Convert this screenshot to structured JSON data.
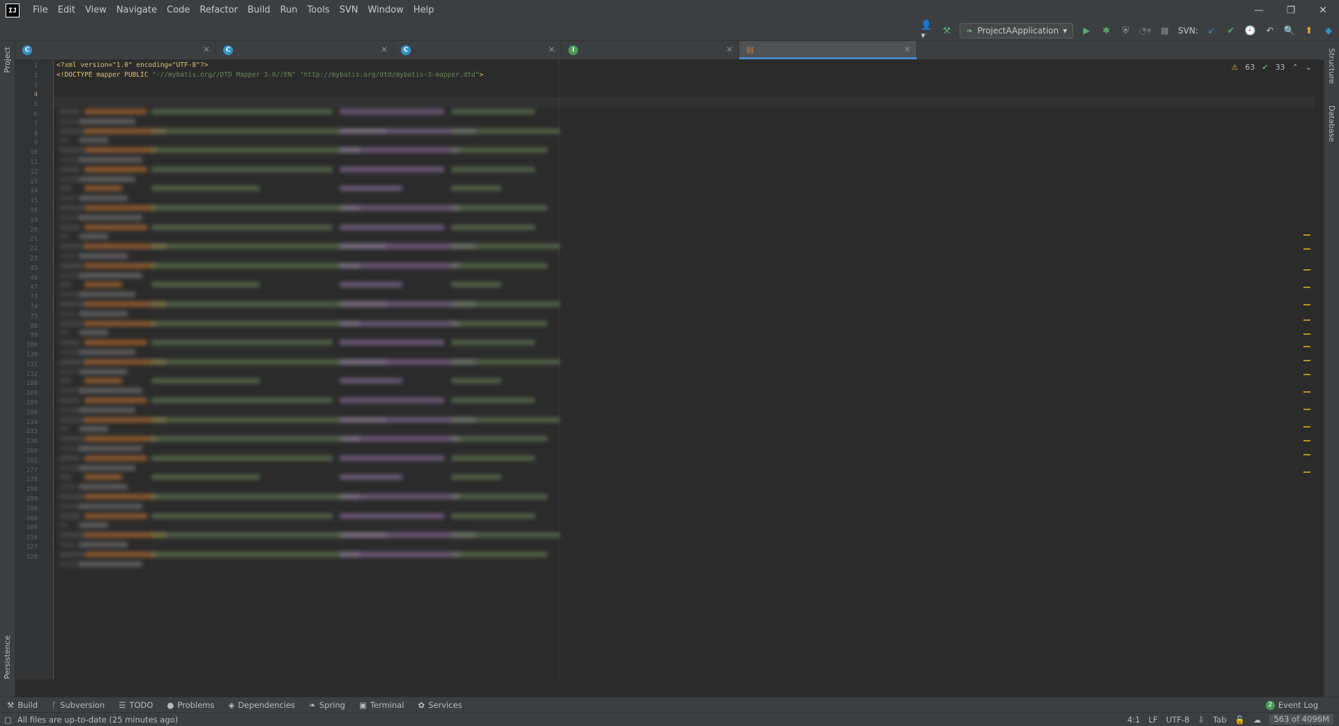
{
  "menu": [
    "File",
    "Edit",
    "View",
    "Navigate",
    "Code",
    "Refactor",
    "Build",
    "Run",
    "Tools",
    "SVN",
    "Window",
    "Help"
  ],
  "app_logo": "IJ",
  "toolbar": {
    "run_config": "ProjectAApplication",
    "svn_label": "SVN:"
  },
  "tabs": [
    {
      "icon": "C",
      "color": "#3592c4"
    },
    {
      "icon": "C",
      "color": "#3592c4"
    },
    {
      "icon": "C",
      "color": "#3592c4"
    },
    {
      "icon": "I",
      "color": "#499c54"
    },
    {
      "icon": "xml",
      "color": "#cc7832"
    }
  ],
  "side": {
    "project": "Project",
    "persistence": "Persistence",
    "structure": "Structure",
    "database": "Database"
  },
  "editor": {
    "line1": "<?xml version=\"1.0\" encoding=\"UTF-8\"?>",
    "line2_a": "<!DOCTYPE mapper PUBLIC ",
    "line2_b": "\"-//mybatis.org//DTD Mapper 3.0//EN\"",
    "line2_c": " ",
    "line2_d": "\"http://mybatis.org/dtd/mybatis-3-mapper.dtd\"",
    "line2_e": ">",
    "line_numbers": [
      "1",
      "2",
      "3",
      "4",
      "5",
      "6",
      "7",
      "8",
      "9",
      "10",
      "11",
      "12",
      "13",
      "14",
      "15",
      "16",
      "19",
      "20",
      "21",
      "22",
      "23",
      "45",
      "46",
      "47",
      "73",
      "74",
      "75",
      "88",
      "99",
      "100",
      "130",
      "131",
      "132",
      "168",
      "169",
      "199",
      "200",
      "234",
      "235",
      "236",
      "260",
      "261",
      "277",
      "278",
      "298",
      "299",
      "300",
      "308",
      "309",
      "310",
      "327",
      "328"
    ],
    "warnings": "63",
    "checks": "33"
  },
  "bottom_tools": [
    {
      "icon": "hammer-icon",
      "glyph": "⚒",
      "label": "Build"
    },
    {
      "icon": "subversion-icon",
      "glyph": "ᚴ",
      "label": "Subversion"
    },
    {
      "icon": "todo-icon",
      "glyph": "☰",
      "label": "TODO"
    },
    {
      "icon": "problems-icon",
      "glyph": "●",
      "label": "Problems"
    },
    {
      "icon": "dependencies-icon",
      "glyph": "◈",
      "label": "Dependencies"
    },
    {
      "icon": "spring-icon",
      "glyph": "❧",
      "label": "Spring"
    },
    {
      "icon": "terminal-icon",
      "glyph": "▣",
      "label": "Terminal"
    },
    {
      "icon": "services-icon",
      "glyph": "✿",
      "label": "Services"
    }
  ],
  "event_log": {
    "count": "2",
    "label": "Event Log"
  },
  "status": {
    "message": "All files are up-to-date (25 minutes ago)",
    "position": "4:1",
    "line_sep": "LF",
    "encoding": "UTF-8",
    "indent": "Tab",
    "memory": "563 of 4096M"
  }
}
